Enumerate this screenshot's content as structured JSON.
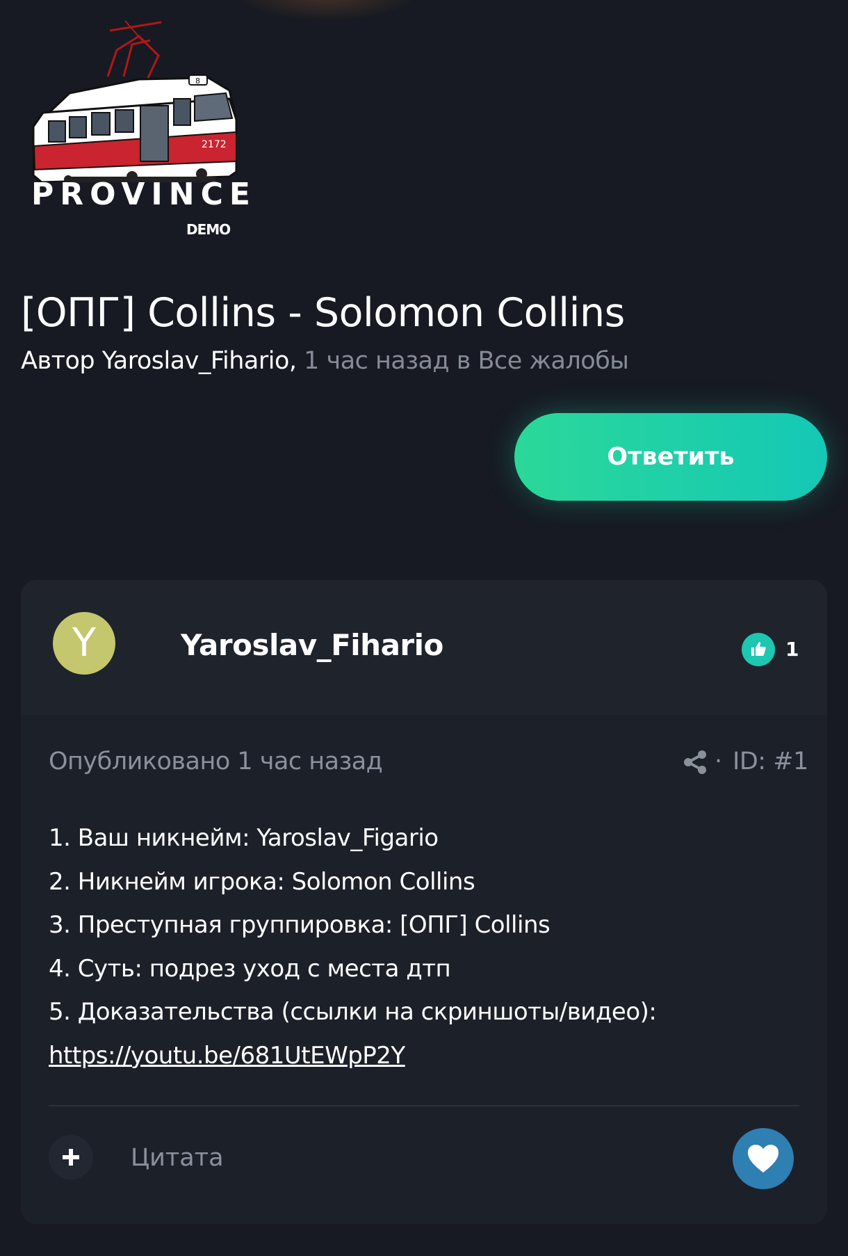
{
  "logo": {
    "word": "PROVINCE",
    "sub": "DEMO",
    "tram_number": "2172",
    "route_number": "8"
  },
  "thread": {
    "title": "[ОПГ] Collins - Solomon Collins",
    "author_prefix": "Автор",
    "author": "Yaroslav_Fihario,",
    "time": "1 час назад",
    "in_word": "в",
    "forum": "Все жалобы"
  },
  "reply_button": {
    "label": "Ответить"
  },
  "post": {
    "avatar_letter": "Y",
    "avatar_color": "#c4c76d",
    "username": "Yaroslav_Fihario",
    "reaction_icon": "thumbs-up-icon",
    "reaction_count": "1",
    "published": "Опубликовано 1 час назад",
    "separator": "·",
    "post_id": "ID: #1",
    "lines": [
      "1. Ваш никнейм: Yaroslav_Figario",
      "2. Никнейм игрока: Solomon Collins",
      "3. Преступная группировка: [ОПГ] Collins",
      "4. Суть: подрез уход с места дтп",
      "5. Доказательства (ссылки на скриншоты/видео):"
    ],
    "link": "https://youtu.be/681UtEWpP2Y",
    "quote_label": "Цитата",
    "like_icon": "heart-icon"
  },
  "colors": {
    "background": "#171a22",
    "accent": "#1dc7b0",
    "like_button": "#2e7fb2",
    "muted_text": "#8a919c"
  }
}
